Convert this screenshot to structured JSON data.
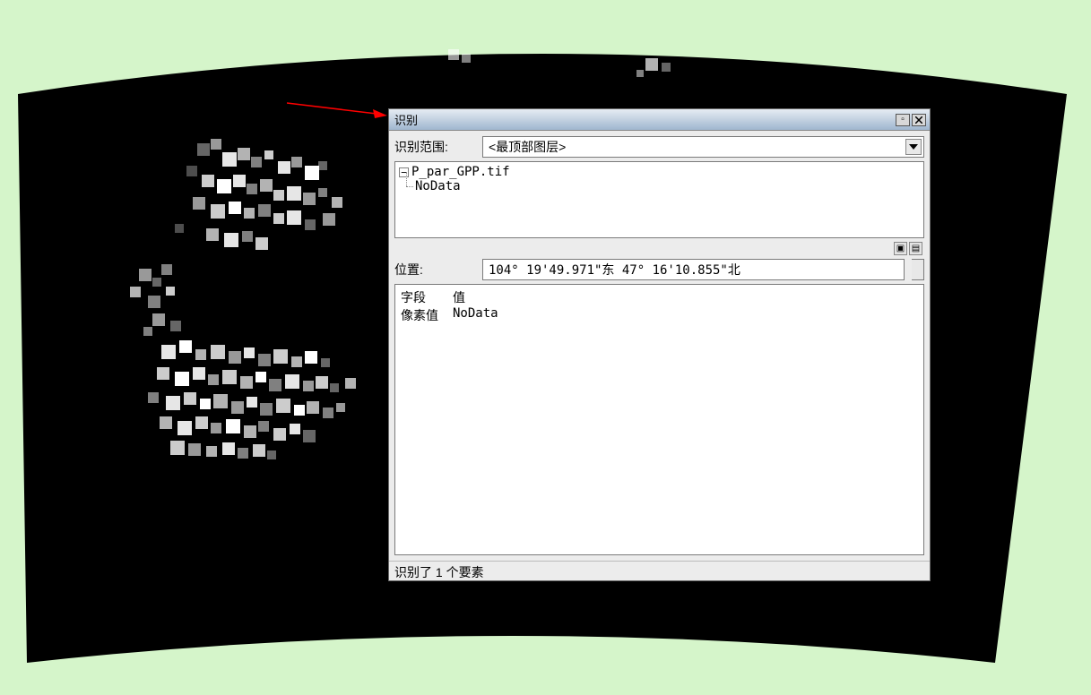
{
  "dialog": {
    "title": "识别",
    "scope_label": "识别范围:",
    "scope_value": "<最顶部图层>",
    "tree_root": "P_par_GPP.tif",
    "tree_child": "NoData",
    "location_label": "位置:",
    "location_value": "104° 19'49.971\"东  47° 16'10.855\"北",
    "fields_header_field": "字段",
    "fields_header_value": "值",
    "field_name": "像素值",
    "field_value": "NoData",
    "status": "识别了 1 个要素"
  }
}
